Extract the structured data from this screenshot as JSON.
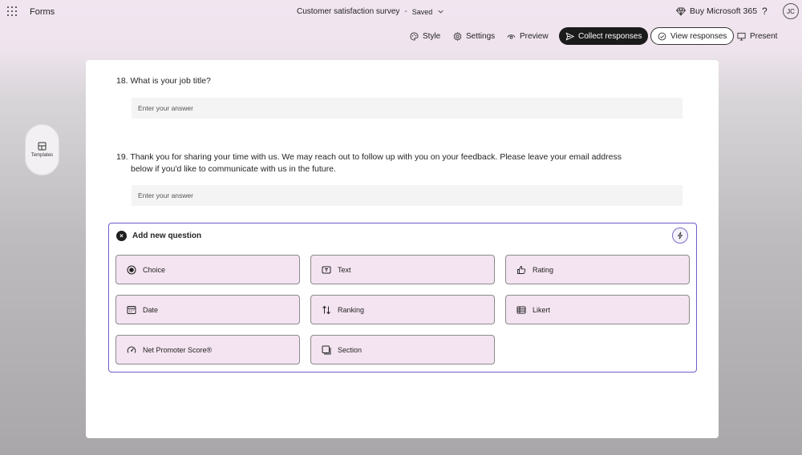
{
  "app": {
    "name": "Forms"
  },
  "header": {
    "form_title": "Customer satisfaction survey",
    "separator": "-",
    "save_status": "Saved",
    "buy_label": "Buy Microsoft 365",
    "help_label": "?",
    "user_initials": "JC"
  },
  "toolbar": {
    "style": "Style",
    "settings": "Settings",
    "preview": "Preview",
    "collect": "Collect responses",
    "view": "View responses",
    "present": "Present"
  },
  "sidebar": {
    "templates": "Templates"
  },
  "questions": [
    {
      "text": "18. What is your job title?",
      "placeholder": "Enter your answer"
    },
    {
      "text": "19. Thank you for sharing your time with us. We may reach out to follow up with you on your feedback. Please leave your email address",
      "text2": "below if you'd like to communicate with us in the future.",
      "placeholder": "Enter your answer"
    }
  ],
  "add_question": {
    "title": "Add new question",
    "options": [
      {
        "label": "Choice",
        "icon": "radio-icon"
      },
      {
        "label": "Text",
        "icon": "text-icon"
      },
      {
        "label": "Rating",
        "icon": "thumb-icon"
      },
      {
        "label": "Date",
        "icon": "calendar-icon"
      },
      {
        "label": "Ranking",
        "icon": "ranking-icon"
      },
      {
        "label": "Likert",
        "icon": "table-icon"
      },
      {
        "label": "Net Promoter Score®",
        "icon": "gauge-icon"
      },
      {
        "label": "Section",
        "icon": "section-icon"
      }
    ]
  },
  "colors": {
    "accent_border": "#6b5fc9",
    "option_fill": "#f4e4f1",
    "dark_button": "#1b1b1b"
  }
}
